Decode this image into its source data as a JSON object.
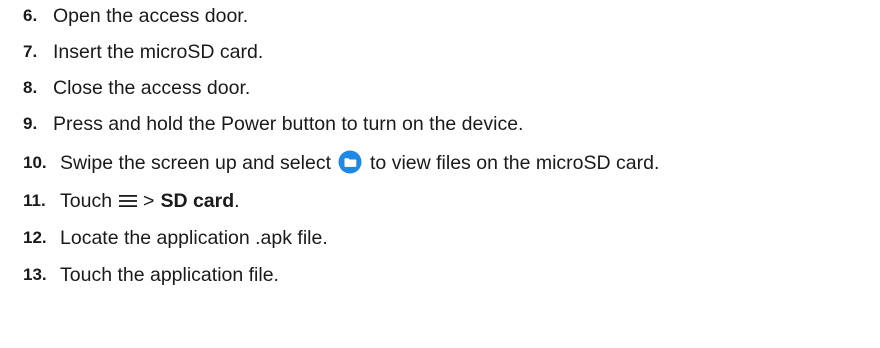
{
  "steps": [
    {
      "number": "6.",
      "text": "Open the access door."
    },
    {
      "number": "7.",
      "text": "Insert the microSD card."
    },
    {
      "number": "8.",
      "text": "Close the access door."
    },
    {
      "number": "9.",
      "text": "Press and hold the Power button to turn on the device."
    },
    {
      "number": "10.",
      "text_before": "Swipe the screen up and select",
      "icon": "files-folder-icon",
      "text_after": "to view files on the microSD card."
    },
    {
      "number": "11.",
      "text_before": "Touch",
      "icon": "menu-icon",
      "separator": ">",
      "bold_text": "SD card",
      "text_after": "."
    },
    {
      "number": "12.",
      "text": "Locate the application .apk file."
    },
    {
      "number": "13.",
      "text": "Touch the application file."
    }
  ],
  "colors": {
    "text": "#1a1a1a",
    "folder_icon": "#1e88e5"
  }
}
